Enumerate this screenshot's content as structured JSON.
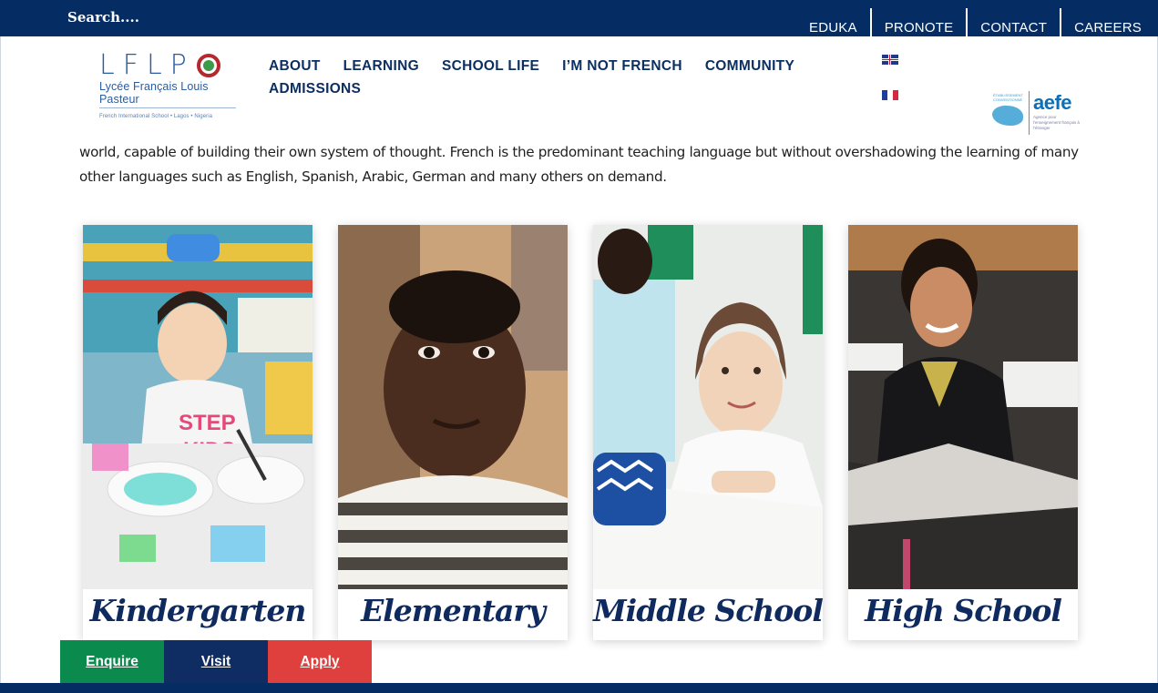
{
  "search": {
    "label": "Search...."
  },
  "top_links": [
    "EDUKA",
    "PRONOTE",
    "CONTACT",
    "CAREERS"
  ],
  "logo": {
    "letters": "LFLP",
    "name": "Lycée Français Louis Pasteur",
    "tagline": "French International School • Lagos • Nigeria"
  },
  "nav": {
    "row1": [
      "ABOUT",
      "LEARNING",
      "SCHOOL LIFE",
      "I’M NOT FRENCH",
      "COMMUNITY"
    ],
    "row2": [
      "ADMISSIONS"
    ]
  },
  "languages": [
    "English",
    "Français"
  ],
  "aefe": {
    "small": "ÉTABLISSEMENT CONVENTIONNÉ",
    "brand": "aefe",
    "sub": "Agence pour l'enseignement français à l'étranger"
  },
  "intro": "world, capable of building their own system of thought. French is the predominant teaching language but without overshadowing the learning of many other languages such as English, Spanish, Arabic, German and many others on demand.",
  "cards": [
    {
      "label": "Kindergarten"
    },
    {
      "label": "Elementary"
    },
    {
      "label": "Middle School"
    },
    {
      "label": "High School"
    }
  ],
  "cta": {
    "enquire": "Enquire",
    "visit": "Visit",
    "apply": "Apply"
  },
  "colors": {
    "navy": "#062d63",
    "enquire_green": "#0a8a4c",
    "visit_navy": "#0f2d63",
    "apply_red": "#e0403d"
  }
}
